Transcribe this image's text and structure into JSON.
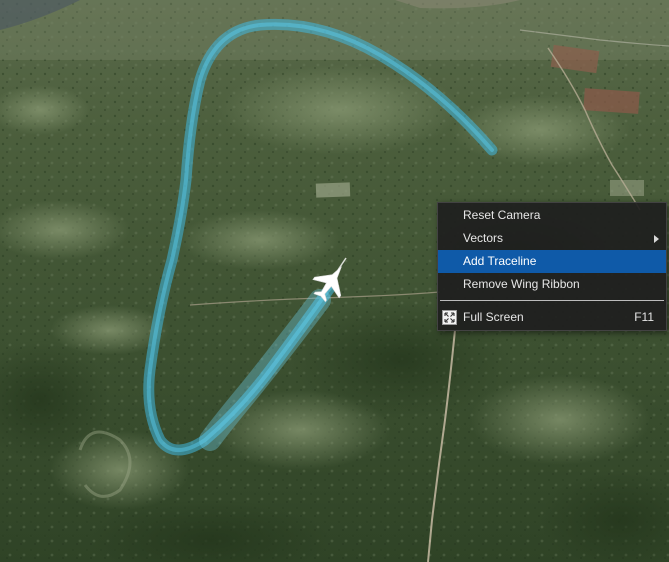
{
  "context_menu": {
    "items": [
      {
        "label": "Reset Camera"
      },
      {
        "label": "Vectors",
        "has_submenu": true
      },
      {
        "label": "Add Traceline",
        "highlighted": true
      },
      {
        "label": "Remove Wing Ribbon"
      },
      {
        "label": "Full Screen",
        "shortcut": "F11",
        "icon": "fullscreen-icon"
      }
    ]
  },
  "colors": {
    "menu_background": "#1e1e1e",
    "menu_highlight": "#0f5aa8",
    "ribbon": "#3fb8e0",
    "aircraft": "#ffffff",
    "terrain": "#3f5331"
  }
}
